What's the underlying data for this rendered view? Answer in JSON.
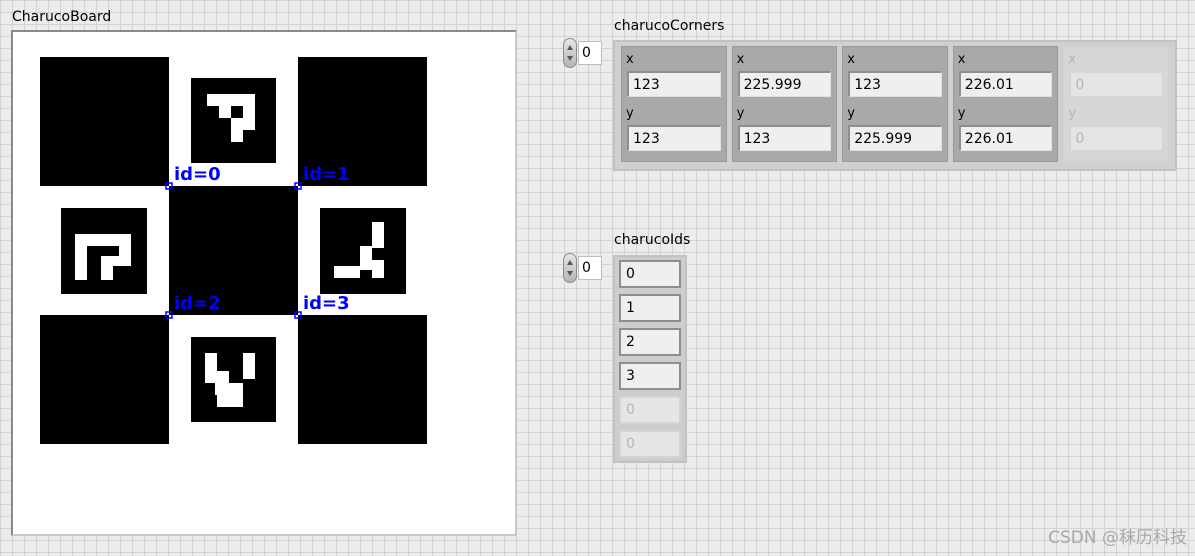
{
  "image_display": {
    "label": "CharucoBoard",
    "corner_labels": [
      "id=0",
      "id=1",
      "id=2",
      "id=3"
    ]
  },
  "charuco_corners": {
    "label": "charucoCorners",
    "index": "0",
    "field_x": "x",
    "field_y": "y",
    "elements": [
      {
        "x": "123",
        "y": "123",
        "enabled": true
      },
      {
        "x": "225.999",
        "y": "123",
        "enabled": true
      },
      {
        "x": "123",
        "y": "225.999",
        "enabled": true
      },
      {
        "x": "226.01",
        "y": "226.01",
        "enabled": true
      },
      {
        "x": "0",
        "y": "0",
        "enabled": false
      }
    ]
  },
  "charuco_ids": {
    "label": "charucoIds",
    "index": "0",
    "values": [
      {
        "v": "0",
        "enabled": true
      },
      {
        "v": "1",
        "enabled": true
      },
      {
        "v": "2",
        "enabled": true
      },
      {
        "v": "3",
        "enabled": true
      },
      {
        "v": "0",
        "enabled": false
      },
      {
        "v": "0",
        "enabled": false
      }
    ]
  },
  "colors": {
    "corner_marker": "#0000ff",
    "disabled_text": "#b5b5b5"
  },
  "watermark": "CSDN @秣历科技"
}
